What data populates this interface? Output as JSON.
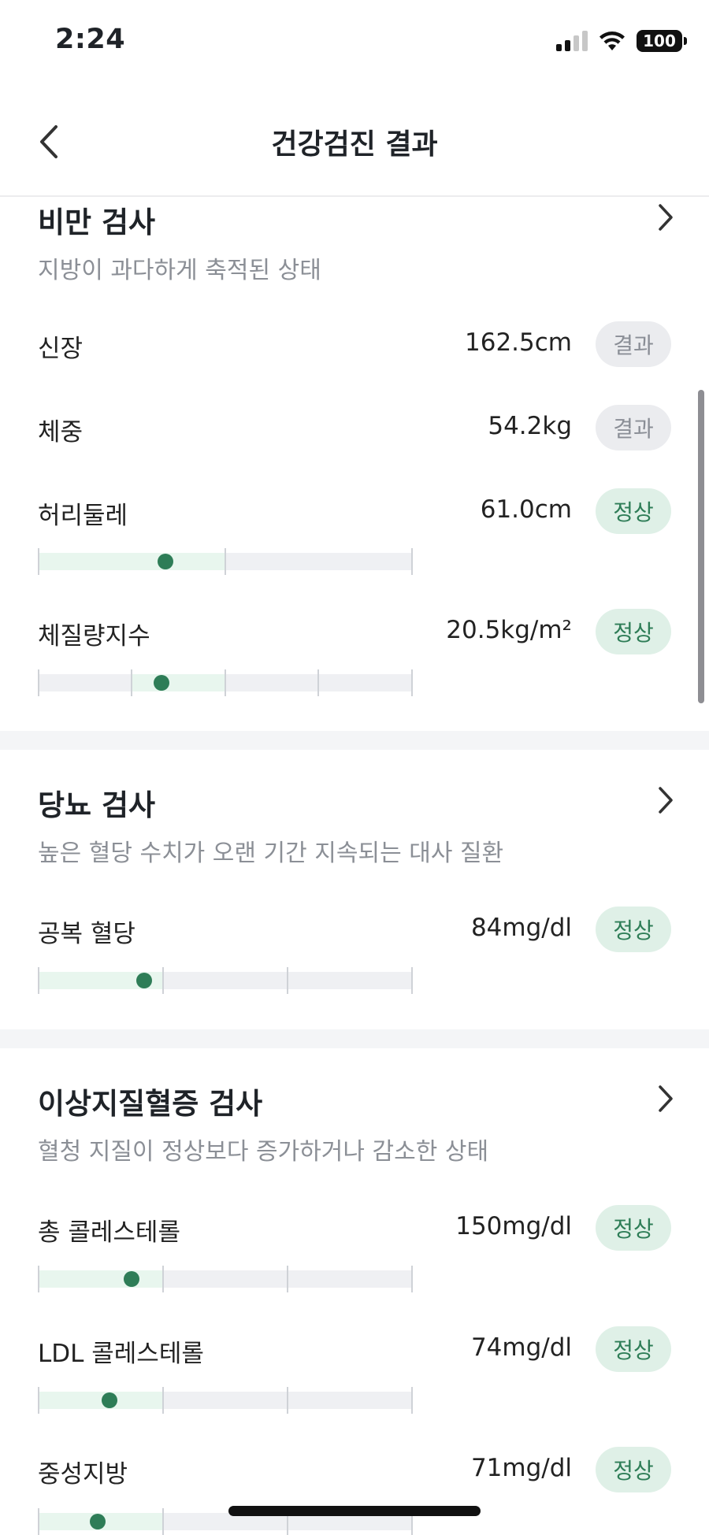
{
  "status_bar": {
    "time": "2:24",
    "battery": "100"
  },
  "header": {
    "title": "건강검진 결과"
  },
  "sections": [
    {
      "title": "비만 검사",
      "description": "지방이 과다하게 축적된 상태",
      "rows": [
        {
          "label": "신장",
          "value": "162.5cm",
          "badge": "결과",
          "status": "result"
        },
        {
          "label": "체중",
          "value": "54.2kg",
          "badge": "결과",
          "status": "result"
        },
        {
          "label": "허리둘레",
          "value": "61.0cm",
          "badge": "정상",
          "status": "normal",
          "range": {
            "segments": 2,
            "normal_segments": 1,
            "position": 0.34
          }
        },
        {
          "label": "체질량지수",
          "value": "20.5kg/m²",
          "badge": "정상",
          "status": "normal",
          "range": {
            "segments": 4,
            "normal_segments": [
              2
            ],
            "position": 0.33
          }
        }
      ]
    },
    {
      "title": "당뇨 검사",
      "description": "높은 혈당 수치가 오랜 기간 지속되는 대사 질환",
      "rows": [
        {
          "label": "공복 혈당",
          "value": "84mg/dl",
          "badge": "정상",
          "status": "normal",
          "range": {
            "segments": 3,
            "normal_segments": 1,
            "position": 0.28
          }
        }
      ]
    },
    {
      "title": "이상지질혈증 검사",
      "description": "혈청 지질이 정상보다 증가하거나 감소한 상태",
      "rows": [
        {
          "label": "총 콜레스테롤",
          "value": "150mg/dl",
          "badge": "정상",
          "status": "normal",
          "range": {
            "segments": 3,
            "normal_segments": 1,
            "position": 0.25
          }
        },
        {
          "label": "LDL 콜레스테롤",
          "value": "74mg/dl",
          "badge": "정상",
          "status": "normal",
          "range": {
            "segments": 3,
            "normal_segments": 1,
            "position": 0.19
          }
        },
        {
          "label": "중성지방",
          "value": "71mg/dl",
          "badge": "정상",
          "status": "normal",
          "range": {
            "segments": 3,
            "normal_segments": 1,
            "position": 0.16
          }
        }
      ]
    }
  ],
  "colors": {
    "accent": "#2e7d57",
    "normal_badge_bg": "#dff0e7",
    "result_badge_bg": "#ebecef",
    "track": "#eff0f3",
    "normal_zone": "#e8f6ee"
  }
}
